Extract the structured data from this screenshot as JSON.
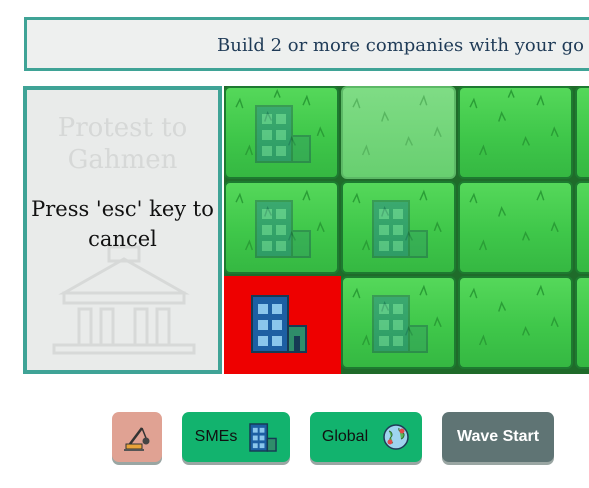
{
  "objective": {
    "text": "Build 2 or more companies with your go"
  },
  "panel": {
    "ghost_title": "Protest to Gahmen",
    "hint": "Press 'esc' key to cancel",
    "building_icon": "government-building-icon"
  },
  "grid": {
    "tiles": [
      {
        "row": 0,
        "col": 0,
        "state": "grass",
        "icon": "office-building-icon-faint"
      },
      {
        "row": 0,
        "col": 1,
        "state": "grass-highlighted",
        "icon": ""
      },
      {
        "row": 0,
        "col": 2,
        "state": "grass",
        "icon": ""
      },
      {
        "row": 1,
        "col": 0,
        "state": "grass",
        "icon": "office-building-icon-faint"
      },
      {
        "row": 1,
        "col": 1,
        "state": "grass",
        "icon": "office-building-icon-faint"
      },
      {
        "row": 1,
        "col": 2,
        "state": "grass",
        "icon": ""
      },
      {
        "row": 2,
        "col": 0,
        "state": "invalid-placement",
        "icon": "office-building-icon"
      },
      {
        "row": 2,
        "col": 1,
        "state": "grass",
        "icon": "office-building-icon-faint"
      },
      {
        "row": 2,
        "col": 2,
        "state": "grass",
        "icon": ""
      }
    ],
    "colors": {
      "grass": "#3fc74a",
      "invalid": "#ee0000",
      "highlight": "#7fdc85"
    }
  },
  "toolbar": {
    "tool_icon": "crane-icon",
    "smes_label": "SMEs",
    "smes_icon": "office-building-icon",
    "global_label": "Global",
    "global_icon": "globe-icon",
    "wave_label": "Wave Start",
    "colors": {
      "tool": "#e0a293",
      "green": "#12b36e",
      "wave": "#5f7474"
    }
  }
}
